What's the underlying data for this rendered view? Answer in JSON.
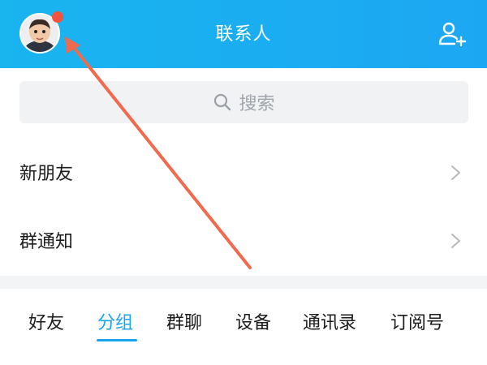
{
  "header": {
    "title": "联系人",
    "background": "#1aabf1"
  },
  "search": {
    "placeholder": "搜索"
  },
  "list": {
    "items": [
      {
        "label": "新朋友"
      },
      {
        "label": "群通知"
      }
    ]
  },
  "tabs": {
    "items": [
      {
        "label": "好友"
      },
      {
        "label": "分组"
      },
      {
        "label": "群聊"
      },
      {
        "label": "设备"
      },
      {
        "label": "通讯录"
      },
      {
        "label": "订阅号"
      }
    ],
    "active": "分组",
    "active_color": "#1aa3f0"
  },
  "annotation": {
    "arrow_color": "#f06a4d"
  }
}
